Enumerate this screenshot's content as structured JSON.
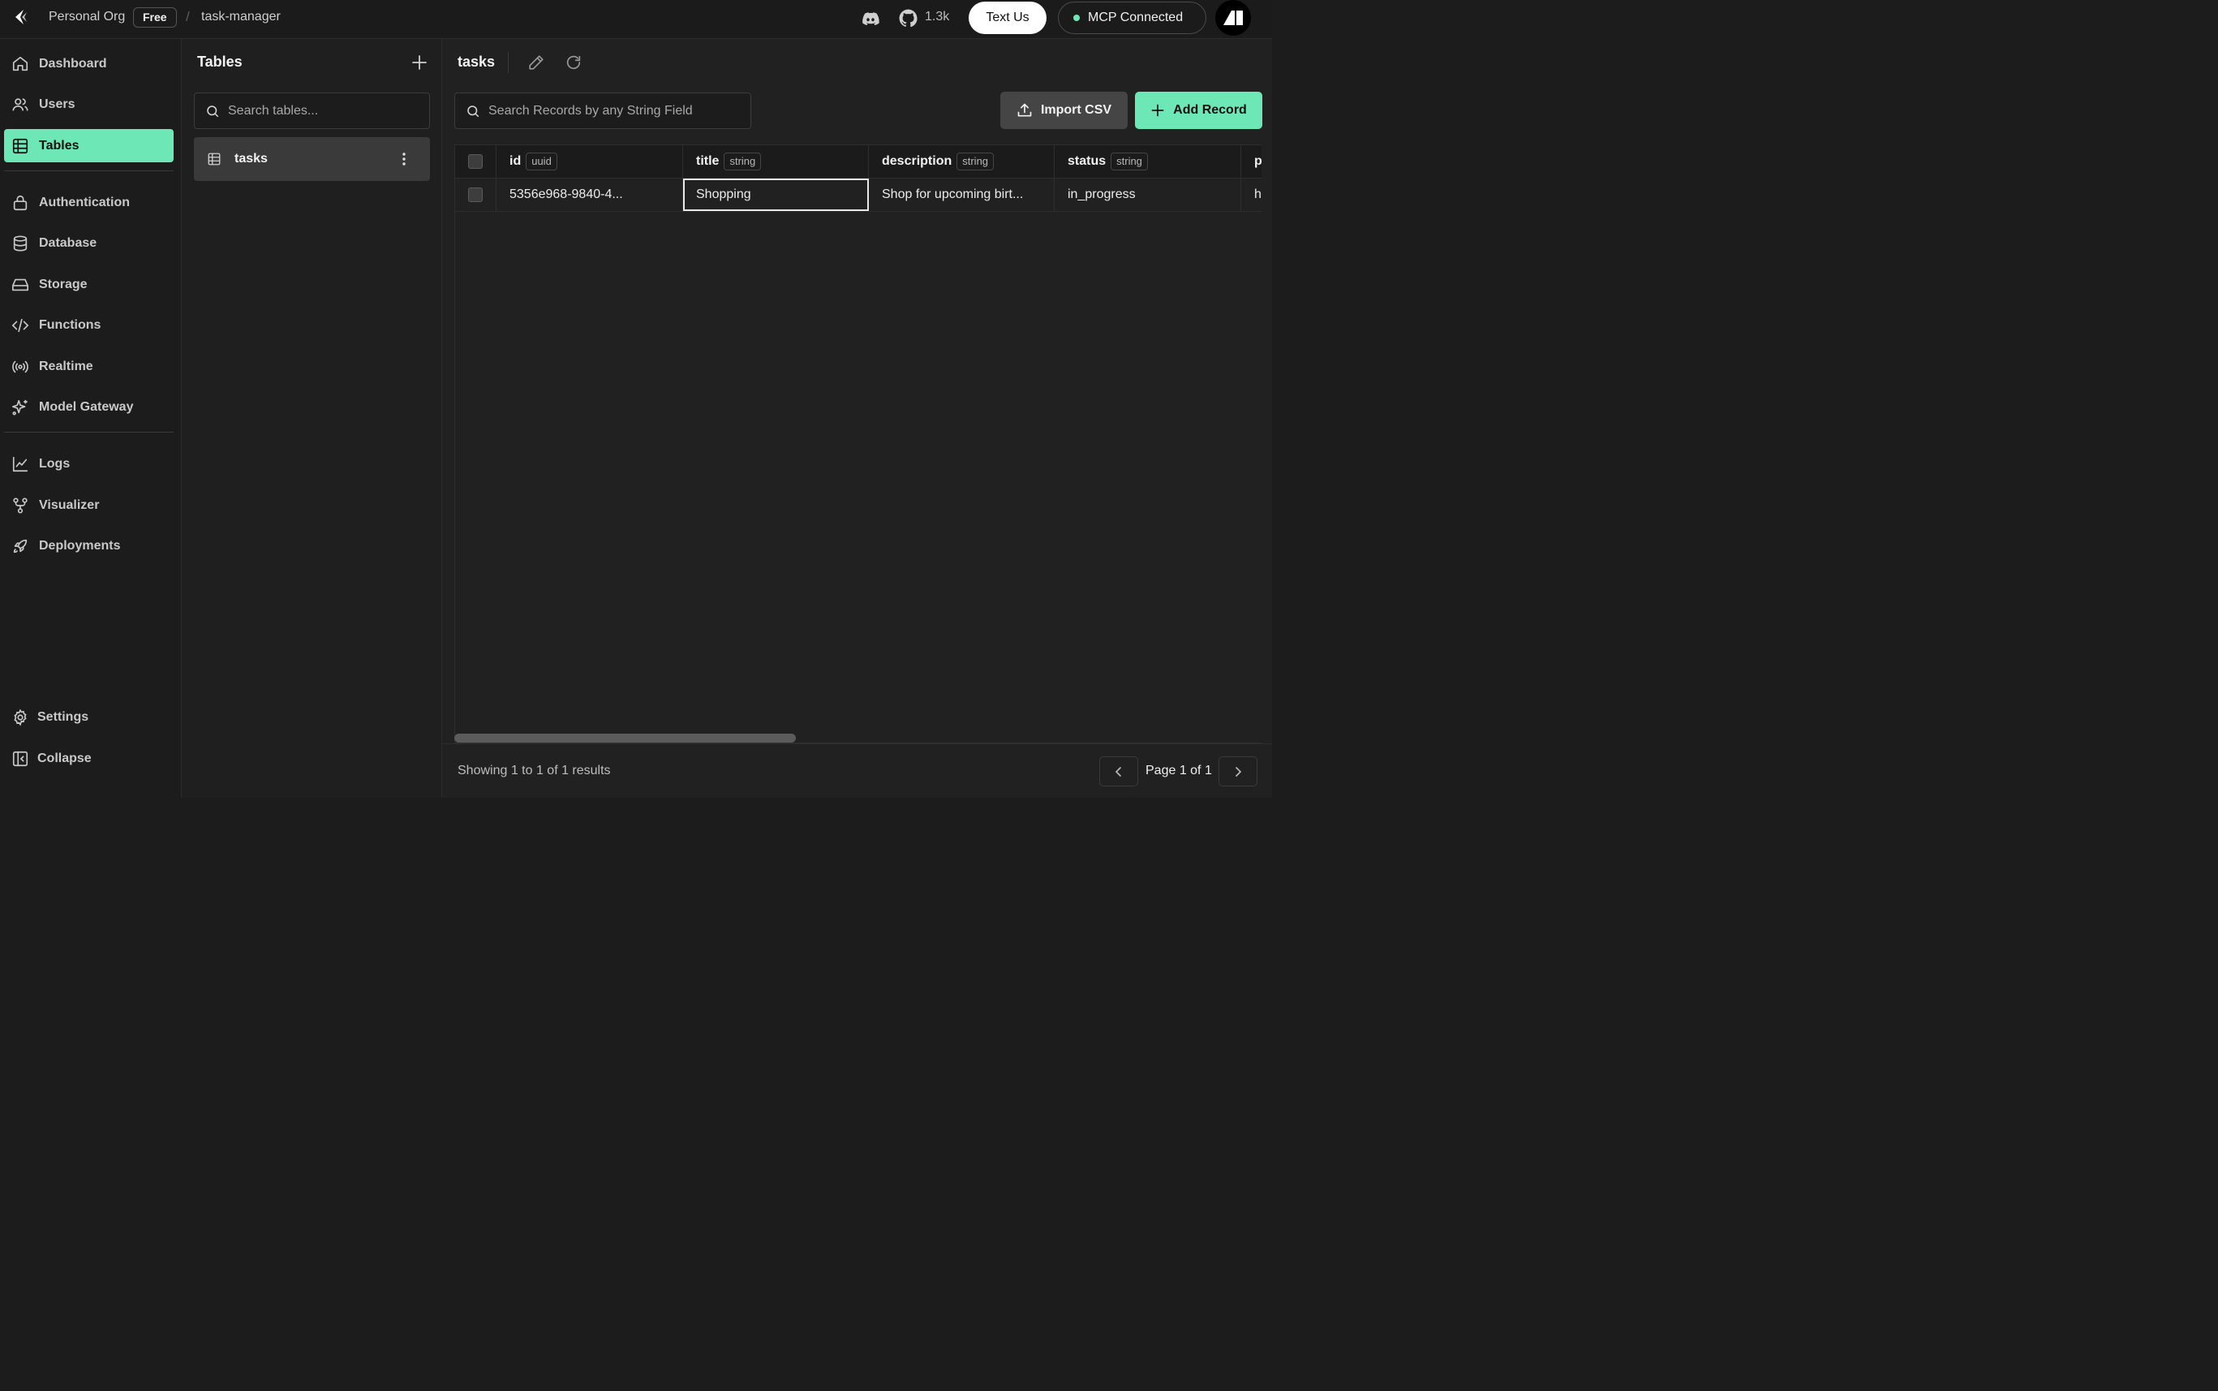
{
  "header": {
    "org_name": "Personal Org",
    "plan": "Free",
    "separator": "/",
    "project": "task-manager",
    "github_stars": "1.3k",
    "text_us": "Text Us",
    "mcp_status": "MCP Connected",
    "accent_color": "#6ee7b7"
  },
  "sidebar": {
    "items": [
      {
        "label": "Dashboard",
        "icon": "home-icon"
      },
      {
        "label": "Users",
        "icon": "users-icon"
      },
      {
        "label": "Tables",
        "icon": "table-icon",
        "active": true
      },
      {
        "label": "Authentication",
        "icon": "lock-icon"
      },
      {
        "label": "Database",
        "icon": "database-icon"
      },
      {
        "label": "Storage",
        "icon": "hard-drive-icon"
      },
      {
        "label": "Functions",
        "icon": "code-icon"
      },
      {
        "label": "Realtime",
        "icon": "radio-icon"
      },
      {
        "label": "Model Gateway",
        "icon": "sparkles-icon"
      },
      {
        "label": "Logs",
        "icon": "line-chart-icon"
      },
      {
        "label": "Visualizer",
        "icon": "git-fork-icon"
      },
      {
        "label": "Deployments",
        "icon": "rocket-icon"
      }
    ],
    "settings": "Settings",
    "collapse": "Collapse"
  },
  "tables_panel": {
    "title": "Tables",
    "search_placeholder": "Search tables...",
    "tables": [
      {
        "name": "tasks"
      }
    ]
  },
  "main": {
    "title": "tasks",
    "search_placeholder": "Search Records by any String Field",
    "import_label": "Import CSV",
    "add_label": "Add Record",
    "columns": [
      {
        "name": "id",
        "type": "uuid"
      },
      {
        "name": "title",
        "type": "string"
      },
      {
        "name": "description",
        "type": "string"
      },
      {
        "name": "status",
        "type": "string"
      },
      {
        "name": "p",
        "type": ""
      }
    ],
    "rows": [
      {
        "id": "5356e968-9840-4...",
        "title": "Shopping",
        "description": "Shop for upcoming birt...",
        "status": "in_progress",
        "more": "h"
      }
    ],
    "results_text": "Showing 1 to 1 of 1 results",
    "page_label": "Page 1 of 1"
  }
}
